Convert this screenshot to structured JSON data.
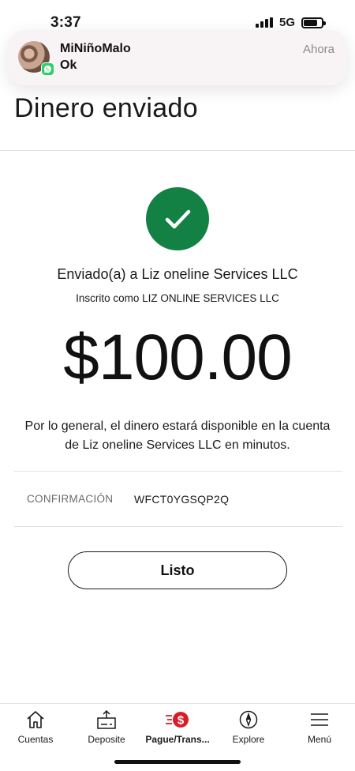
{
  "status_bar": {
    "time": "3:37",
    "network": "5G"
  },
  "notification": {
    "sender": "MiNiñoMalo",
    "message": "Ok",
    "time": "Ahora",
    "app_icon": "whatsapp-icon"
  },
  "page": {
    "title": "Dinero enviado"
  },
  "confirmation": {
    "sent_to": "Enviado(a) a Liz oneline Services LLC",
    "enrolled_as": "Inscrito como LIZ ONLINE SERVICES LLC",
    "amount": "$100.00",
    "availability": "Por lo general, el dinero estará disponible en la cuenta de Liz oneline Services LLC en minutos.",
    "confirmation_label": "CONFIRMACIÓN",
    "confirmation_number": "WFCT0YGSQP2Q",
    "done_label": "Listo"
  },
  "tab_bar": {
    "items": [
      {
        "label": "Cuentas",
        "icon": "home-icon"
      },
      {
        "label": "Deposite",
        "icon": "deposit-icon"
      },
      {
        "label": "Pague/Trans...",
        "icon": "pay-transfer-icon",
        "badge": "$",
        "active": true
      },
      {
        "label": "Explore",
        "icon": "compass-icon"
      },
      {
        "label": "Menú",
        "icon": "menu-icon"
      }
    ]
  },
  "colors": {
    "success_green": "#138143",
    "brand_red": "#d71e28",
    "divider": "#e2e2e2",
    "whatsapp_green": "#25d366"
  }
}
